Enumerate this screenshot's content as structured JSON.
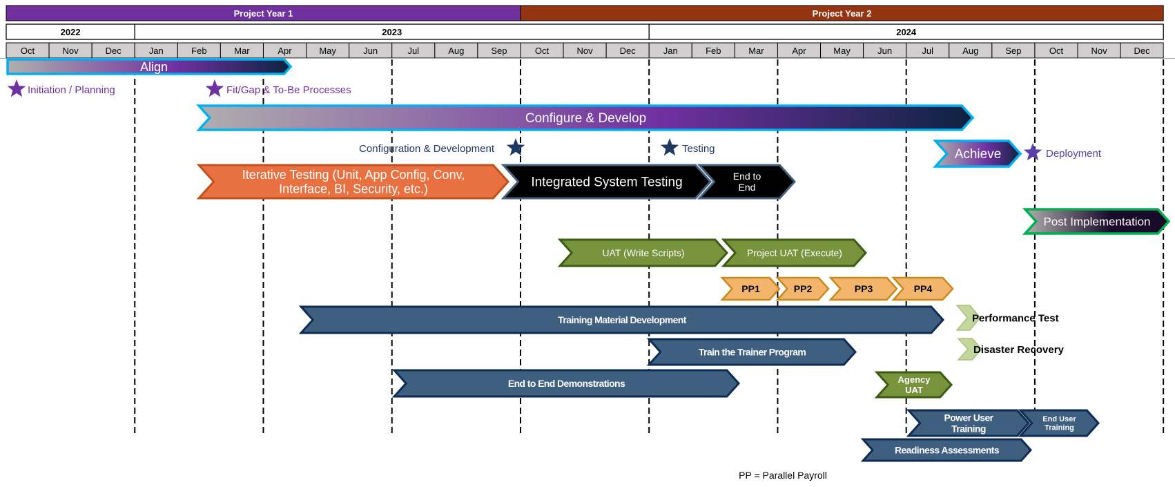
{
  "header": {
    "project_years": [
      {
        "label": "Project Year 1",
        "color": "#7030a0"
      },
      {
        "label": "Project Year 2",
        "color": "#943410"
      }
    ],
    "years": [
      "2022",
      "2023",
      "2024"
    ],
    "months": [
      "Oct",
      "Nov",
      "Dec",
      "Jan",
      "Feb",
      "Mar",
      "Apr",
      "May",
      "Jun",
      "Jul",
      "Aug",
      "Sep",
      "Oct",
      "Nov",
      "Dec",
      "Jan",
      "Feb",
      "Mar",
      "Apr",
      "May",
      "Jun",
      "Jul",
      "Aug",
      "Sep",
      "Oct",
      "Nov",
      "Dec"
    ],
    "month_fill": "#d0cece"
  },
  "phases": {
    "align": {
      "lines": [
        "Align"
      ]
    },
    "configure": {
      "lines": [
        "Configure & Develop"
      ]
    },
    "achieve": {
      "lines": [
        "Achieve"
      ]
    },
    "post_implementation": {
      "lines": [
        "Post Implementation"
      ]
    }
  },
  "tasks": {
    "iterative_testing": {
      "lines": [
        "Iterative Testing (Unit, App Config, Conv,",
        "Interface, BI, Security, etc.)"
      ]
    },
    "integrated_system_testing": {
      "lines": [
        "Integrated System Testing"
      ]
    },
    "end_to_end": {
      "lines": [
        "End to",
        "End"
      ]
    },
    "uat_write_scripts": {
      "lines": [
        "UAT (Write Scripts)"
      ]
    },
    "project_uat": {
      "lines": [
        "Project UAT (Execute)"
      ]
    },
    "pp1": {
      "lines": [
        "PP1"
      ]
    },
    "pp2": {
      "lines": [
        "PP2"
      ]
    },
    "pp3": {
      "lines": [
        "PP3"
      ]
    },
    "pp4": {
      "lines": [
        "PP4"
      ]
    },
    "training_material": {
      "lines": [
        "Training Material Development"
      ]
    },
    "train_the_trainer": {
      "lines": [
        "Train the Trainer Program"
      ]
    },
    "e2e_demos": {
      "lines": [
        "End to End Demonstrations"
      ]
    },
    "agency_uat": {
      "lines": [
        "Agency",
        "UAT"
      ]
    },
    "power_user_training": {
      "lines": [
        "Power User",
        "Training"
      ]
    },
    "end_user_training": {
      "lines": [
        "End User",
        "Training"
      ]
    },
    "readiness": {
      "lines": [
        "Readiness Assessments"
      ]
    },
    "performance_test": {
      "lines": [
        "Performance Test"
      ]
    },
    "disaster_recovery": {
      "lines": [
        "Disaster Recovery"
      ]
    }
  },
  "milestones": {
    "initiation": {
      "label": "Initiation / Planning",
      "icon": "star-icon",
      "color": "#7030a0"
    },
    "fit_gap": {
      "label": "Fit/Gap & To-Be Processes",
      "icon": "star-icon",
      "color": "#7030a0"
    },
    "config_dev": {
      "label": "Configuration & Development",
      "icon": "star-icon",
      "color": "#1f3864"
    },
    "testing": {
      "label": "Testing",
      "icon": "star-icon",
      "color": "#1f3864"
    },
    "deployment": {
      "label": "Deployment",
      "icon": "star-icon",
      "color": "#5b3fa8"
    }
  },
  "footnote": "PP = Parallel Payroll",
  "colors": {
    "cyan_border": "#00b0f0",
    "orange": "#e97141",
    "black": "#000000",
    "green": "#77933c",
    "peach": "#f2b56b",
    "blue": "#3e5f7f",
    "light_green": "#c3d69b"
  }
}
